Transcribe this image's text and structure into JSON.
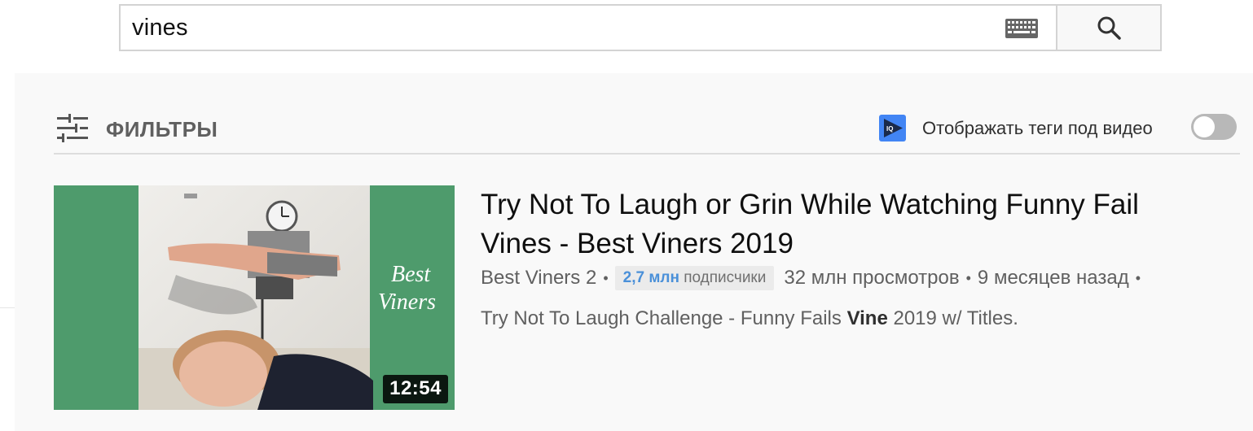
{
  "search": {
    "query": "vines",
    "keyboard_icon": "keyboard-icon",
    "search_icon": "search-icon"
  },
  "filters": {
    "label": "ФИЛЬТРЫ",
    "icon": "filters-icon"
  },
  "tags_toggle": {
    "label": "Отображать теги под видео",
    "badge_icon": "iq-badge-icon",
    "enabled": false
  },
  "video": {
    "title": "Try Not To Laugh or Grin While Watching Funny Fail Vines - Best Viners 2019",
    "duration": "12:54",
    "channel": "Best Viners 2",
    "subscribers_count": "2,7 млн",
    "subscribers_label": "подписчики",
    "views": "32 млн просмотров",
    "age": "9 месяцев назад",
    "separator": "•",
    "thumbnail_text_line1": "Best",
    "thumbnail_text_line2": "Viners",
    "description_before": "Try Not To Laugh Challenge - Funny Fails ",
    "description_bold": "Vine",
    "description_after": " 2019 w/ Titles."
  },
  "colors": {
    "thumbnail_green": "#4e9b6c",
    "subscriber_blue": "#4a90d9",
    "badge_blue": "#4285f4",
    "panel_bg": "#f9f9f9"
  }
}
